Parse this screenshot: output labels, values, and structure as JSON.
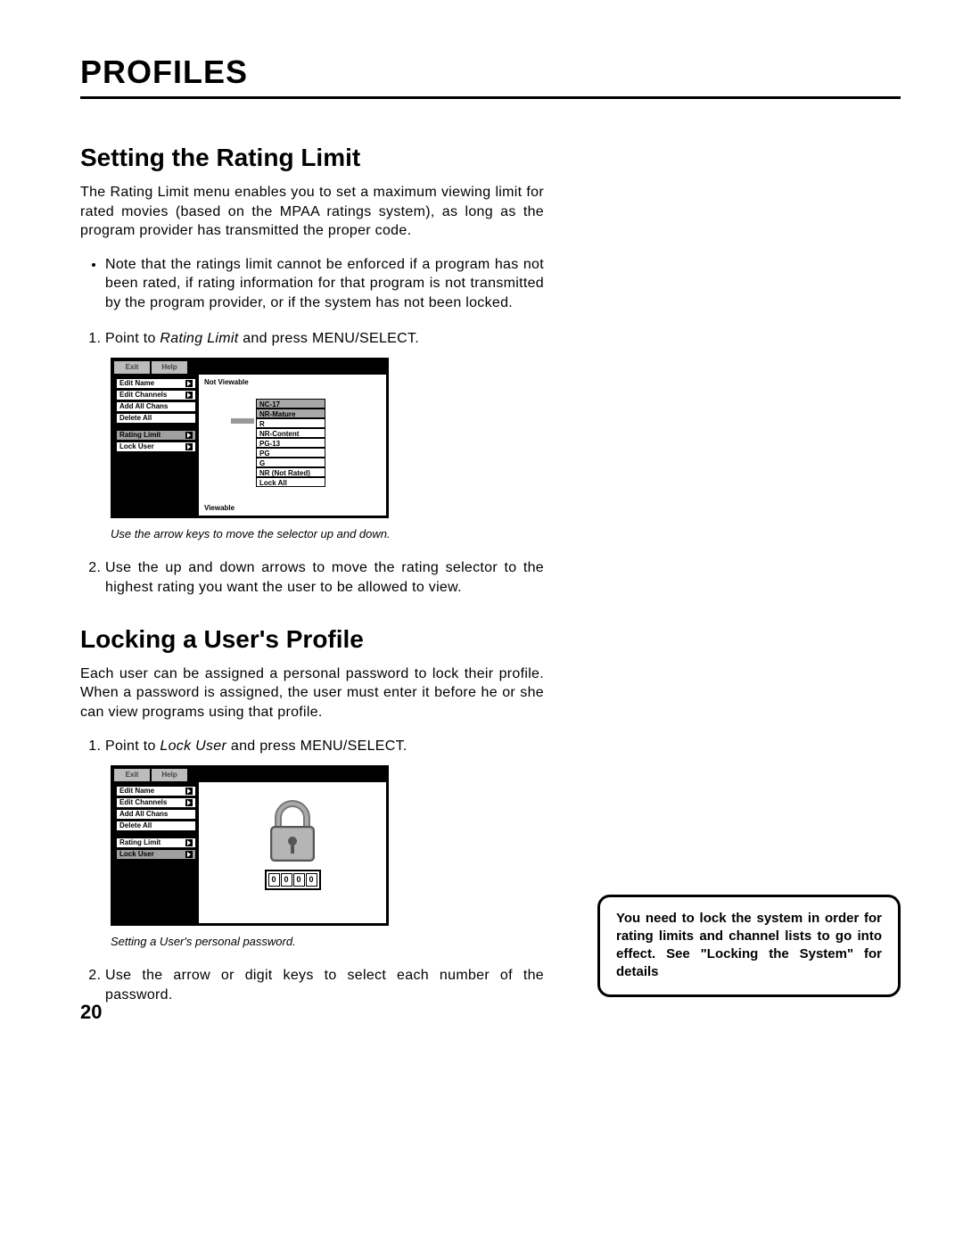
{
  "page": {
    "title": "PROFILES",
    "number": "20"
  },
  "section1": {
    "heading": "Setting the Rating Limit",
    "intro": "The Rating Limit menu enables you to set a maximum viewing limit for rated movies (based on the MPAA ratings system), as long as the program provider has transmitted the proper code.",
    "bullet": "Note that the ratings limit cannot be enforced if a program has not been rated, if rating information for that program is not transmitted by the program provider, or if the system has not been locked.",
    "step1_a": "Point to ",
    "step1_em": "Rating Limit",
    "step1_b": " and press MENU/SELECT.",
    "caption": "Use the arrow keys to move the selector up and down.",
    "step2": "Use the up and down arrows to move the rating selector to the highest rating you want the user to be allowed to view."
  },
  "section2": {
    "heading": "Locking a User's Profile",
    "intro": "Each user can be assigned a personal password to lock their profile. When a password is assigned, the user must enter it before he or she can view programs using that profile.",
    "step1_a": "Point to ",
    "step1_em": "Lock User",
    "step1_b": " and press MENU/SELECT.",
    "caption": "Setting a User's personal password.",
    "step2": "Use the arrow or digit keys to select each number of the password."
  },
  "fig_common": {
    "topbar": {
      "exit": "Exit",
      "help": "Help"
    },
    "menu": {
      "edit_name": "Edit Name",
      "edit_channels": "Edit Channels",
      "add_all": "Add All Chans",
      "delete_all": "Delete All",
      "rating_limit": "Rating Limit",
      "lock_user": "Lock User"
    }
  },
  "fig_rating": {
    "not_viewable": "Not Viewable",
    "viewable": "Viewable",
    "ratings": [
      "NC-17",
      "NR-Mature",
      "R",
      "NR-Content",
      "PG-13",
      "PG",
      "G",
      "NR (Not Rated)",
      "Lock All"
    ]
  },
  "fig_lock": {
    "digits": [
      "0",
      "0",
      "0",
      "0"
    ]
  },
  "note": "You need to lock the system in order for rating limits and channel lists to go into effect. See \"Locking the System\" for details"
}
